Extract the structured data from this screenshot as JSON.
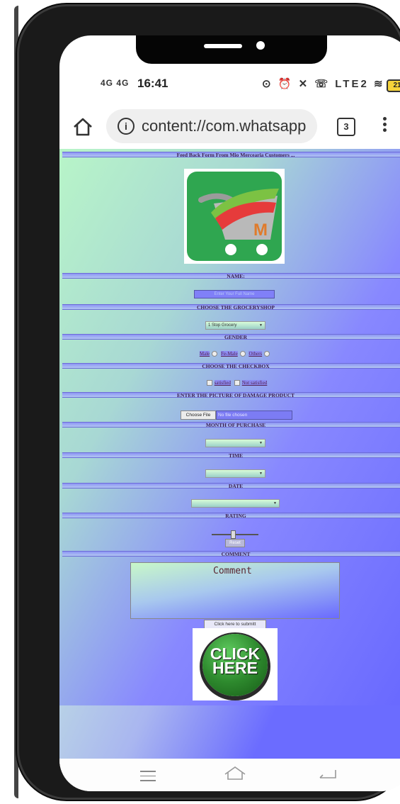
{
  "status_bar": {
    "signal": "4G 4G",
    "time": "16:41",
    "icons": "⊙ ⏰ ✕ ☏ LTE2 ≋",
    "battery": "21"
  },
  "browser": {
    "url": "content://com.whatsapp",
    "tab_count": "3",
    "info_glyph": "i"
  },
  "form": {
    "title": "Feed Back Form From Mio Mercearia Customers ...",
    "name_label": "NAME:",
    "name_placeholder": "Enter Your Full Name",
    "shop_label": "CHOOSE THE GROCERYSHOP",
    "shop_selected": "1 Stop Grocery",
    "gender_label": "GENDER",
    "gender_options": [
      "Male",
      "Fe-Male",
      "Others"
    ],
    "checkbox_label": "CHOOSE THE CHECKBOX",
    "checkbox_options": [
      "satisfied",
      "Not satisfied"
    ],
    "picture_label": "ENTER THE PICTURE OF DAMAGE PRODUCT",
    "file_button": "Choose File",
    "file_status": "No file chosen",
    "month_label": "MONTH OF PURCHASE",
    "time_label": "TIME",
    "date_label": "DATE",
    "rating_label": "RATING",
    "rating_value": 0.45,
    "reset_label": "Reset",
    "comment_label": "COMMENT",
    "comment_placeholder": "Comment",
    "submit_label": "Click here to submitt",
    "click_image_text": "CLICK HERE"
  },
  "colors": {
    "bar": "#8d95f4",
    "logo_green": "#2fa650",
    "page_purple": "#6b6cff",
    "page_green": "#c6f5c6"
  }
}
